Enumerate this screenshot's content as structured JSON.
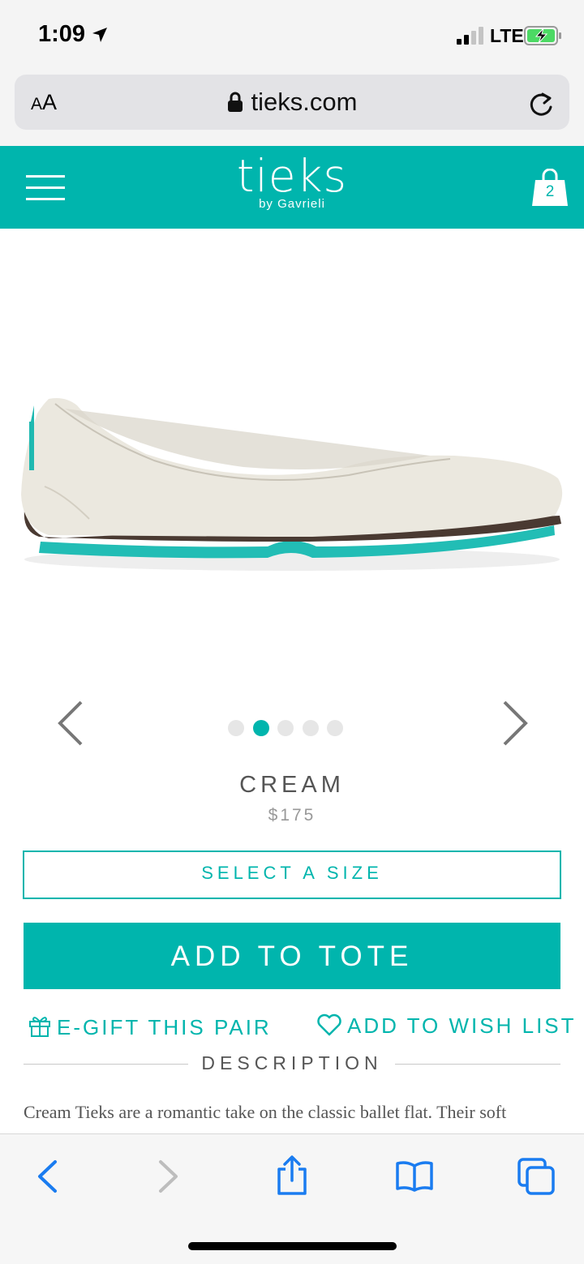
{
  "status_bar": {
    "time": "1:09",
    "network": "LTE"
  },
  "browser": {
    "aa_label_small": "A",
    "aa_label_large": "A",
    "url": "tieks.com"
  },
  "header": {
    "logo_main": "tieks",
    "logo_sub": "by Gavrieli",
    "cart_count": "2"
  },
  "carousel": {
    "dot_count": 5,
    "active_index": 1
  },
  "product": {
    "name": "CREAM",
    "price": "$175",
    "select_size_label": "SELECT A SIZE",
    "add_to_tote_label": "ADD TO TOTE",
    "egift_label": "E-GIFT THIS PAIR",
    "wishlist_label": "ADD TO WISH LIST"
  },
  "description": {
    "heading": "DESCRIPTION",
    "text": "Cream Tieks are a romantic take on the classic ballet flat. Their soft"
  },
  "colors": {
    "brand_teal": "#00b5ad",
    "shoe_cream": "#ebe8df"
  },
  "toolbar": {
    "icons": [
      "back-icon",
      "forward-icon",
      "share-icon",
      "bookmarks-icon",
      "tabs-icon"
    ]
  }
}
